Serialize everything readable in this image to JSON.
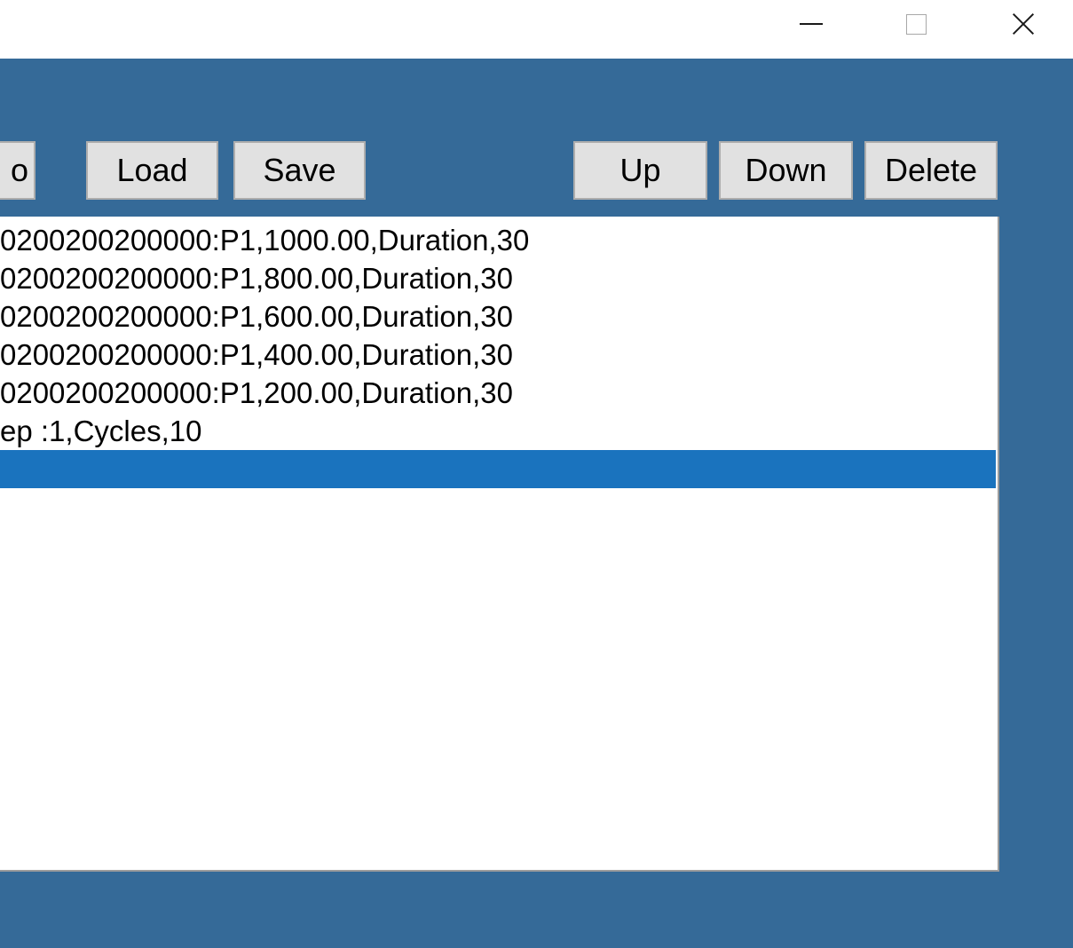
{
  "window": {
    "controls": {
      "minimize_icon": "minimize-icon",
      "maximize_icon": "maximize-icon",
      "close_icon": "close-icon"
    }
  },
  "toolbar": {
    "partial_label": "o",
    "load_label": "Load",
    "save_label": "Save",
    "up_label": "Up",
    "down_label": "Down",
    "delete_label": "Delete"
  },
  "list": {
    "items": [
      "0200200200000:P1,1000.00,Duration,30",
      "0200200200000:P1,800.00,Duration,30",
      "0200200200000:P1,600.00,Duration,30",
      "0200200200000:P1,400.00,Duration,30",
      "0200200200000:P1,200.00,Duration,30",
      "ep :1,Cycles,10",
      ""
    ],
    "selected_index": 6
  },
  "colors": {
    "window_background": "#356a98",
    "selection": "#1a73be",
    "button_face": "#e1e1e1"
  }
}
